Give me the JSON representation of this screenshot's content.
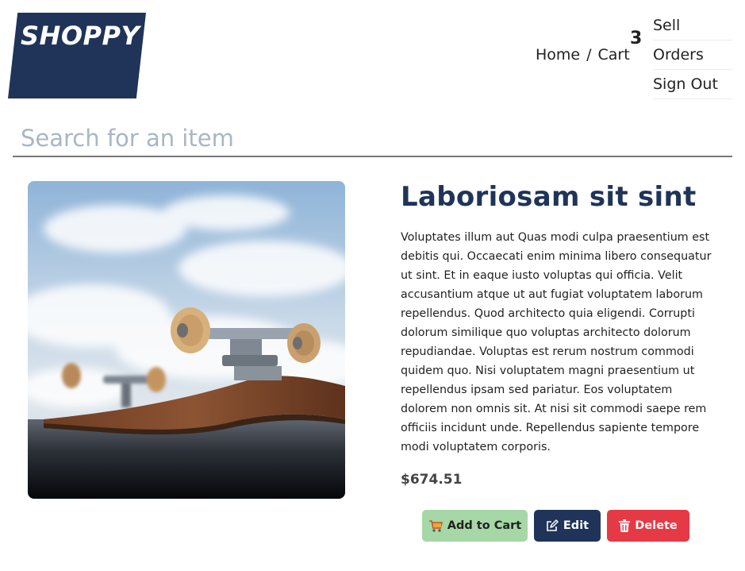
{
  "header": {
    "logo_text": "SHOPPY",
    "breadcrumb": {
      "home_label": "Home",
      "separator": "/",
      "cart_label": "Cart"
    },
    "cart_count": "3",
    "menu": [
      {
        "label": "Sell"
      },
      {
        "label": "Orders"
      },
      {
        "label": "Sign Out"
      }
    ]
  },
  "search": {
    "placeholder": "Search for an item",
    "value": ""
  },
  "product": {
    "image_alt": "Skateboard",
    "title": "Laboriosam sit sint",
    "description": "Voluptates illum aut Quas modi culpa praesentium est debitis qui. Occaecati enim minima libero consequatur ut sint. Et in eaque iusto voluptas qui officia. Velit accusantium atque ut aut fugiat voluptatem laborum repellendus. Quod architecto quia eligendi. Corrupti dolorum similique quo voluptas architecto dolorum repudiandae. Voluptas est rerum nostrum commodi quidem quo. Nisi voluptatem magni praesentium ut repellendus ipsam sed pariatur. Eos voluptatem dolorem non omnis sit. At nisi sit commodi saepe rem officiis incidunt unde. Repellendus sapiente tempore modi voluptatem corporis.",
    "price": "$674.51"
  },
  "actions": {
    "add_to_cart_label": "Add to Cart",
    "edit_label": "Edit",
    "delete_label": "Delete",
    "icons": {
      "add_to_cart": "cart-icon",
      "edit": "edit-icon",
      "delete": "trash-icon"
    }
  },
  "colors": {
    "brand_navy": "#1f3458",
    "add_to_cart_bg": "#a6d7a6",
    "delete_bg": "#e63946",
    "search_placeholder": "#a9b6c6"
  }
}
